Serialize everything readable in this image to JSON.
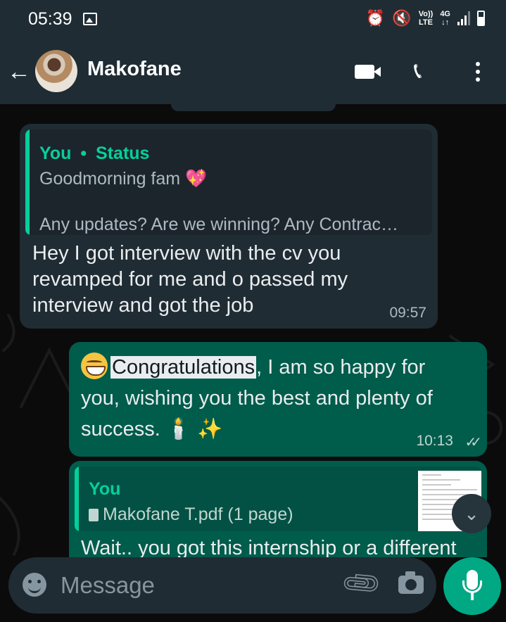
{
  "status_bar": {
    "time": "05:39",
    "network_top": "Vo))",
    "network_bottom": "LTE",
    "data_type": "4G",
    "data_arrows": "↓↑",
    "signal_level": 0.75
  },
  "app_bar": {
    "contact_name": "Makofane",
    "icons": [
      "back-arrow-icon",
      "avatar",
      "video-call-icon",
      "voice-call-icon",
      "more-options-icon"
    ]
  },
  "messages": [
    {
      "direction": "incoming",
      "quote": {
        "author": "You",
        "separator": "•",
        "context": "Status",
        "line1": "Goodmorning fam 💖",
        "line2": "Any updates? Are we winning? Any Contrac…"
      },
      "text_lines": [
        "Hey I got interview with the cv you",
        "revamped for me and o passed my",
        "interview and got the job"
      ],
      "time": "09:57"
    },
    {
      "direction": "outgoing",
      "highlighted_word": "Congratulations",
      "text_line1_rest": ", I am so happy for",
      "text_line2": "you, wishing you the best and plenty of",
      "text_line3": "success. 🕯️ ✨",
      "time": "10:13",
      "ticks": "✓✓"
    },
    {
      "direction": "outgoing",
      "quote": {
        "author": "You",
        "attachment": "Makofane T.pdf (1 page)"
      },
      "text_partial": "Wait.. you got this internship or a different"
    }
  ],
  "composer": {
    "placeholder": "Message"
  },
  "colors": {
    "header": "#1f2c34",
    "incoming_bubble": "#202c33",
    "outgoing_bubble": "#005c4b",
    "accent": "#00a884",
    "quote_name": "#06cf9c"
  }
}
